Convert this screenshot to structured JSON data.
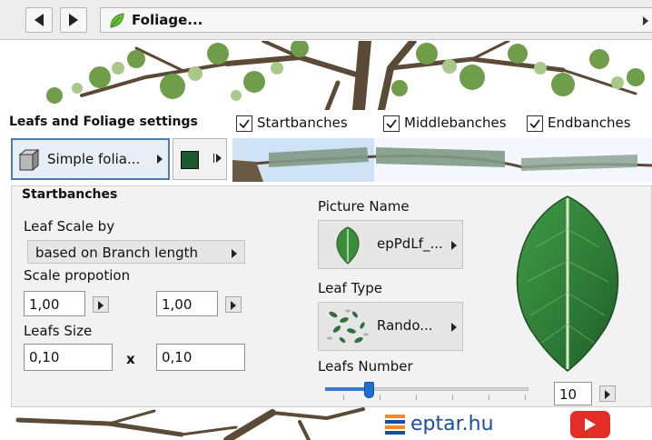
{
  "topbar": {
    "back_icon": "triangle-left-icon",
    "forward_icon": "triangle-right-icon",
    "breadcrumb_icon": "leaf-icon",
    "breadcrumb_label": "Foliage..."
  },
  "settings": {
    "title": "Leafs and Foliage settings",
    "checkboxes": [
      {
        "label": "Startbanches",
        "checked": true
      },
      {
        "label": "Middlebanches",
        "checked": true
      },
      {
        "label": "Endbanches",
        "checked": true
      }
    ]
  },
  "foliage_type": {
    "label": "Simple folia...",
    "icon": "cube-icon"
  },
  "foliage_color": {
    "value": "#1c5a2b"
  },
  "section": {
    "title": "Startbanches",
    "leaf_scale_by_label": "Leaf Scale by",
    "leaf_scale_by_value": "based on Branch length",
    "scale_proportion_label": "Scale propotion",
    "scale_value_1": "1,00",
    "scale_value_2": "1,00",
    "leafs_size_label": "Leafs Size",
    "leafs_size_w": "0,10",
    "leafs_size_sep": "x",
    "leafs_size_h": "0,10",
    "picture_name_label": "Picture Name",
    "picture_name_value": "epPdLf_...",
    "leaf_type_label": "Leaf Type",
    "leaf_type_value": "Rando...",
    "leafs_number_label": "Leafs Number",
    "leafs_number_value": "10",
    "leafs_number_slider_fraction": 0.2
  },
  "footer": {
    "logo_text": "eptar.hu"
  },
  "colors": {
    "accent": "#1e6fd0",
    "selection": "#4a7cb8",
    "leaf_green": "#2e8a3c"
  }
}
